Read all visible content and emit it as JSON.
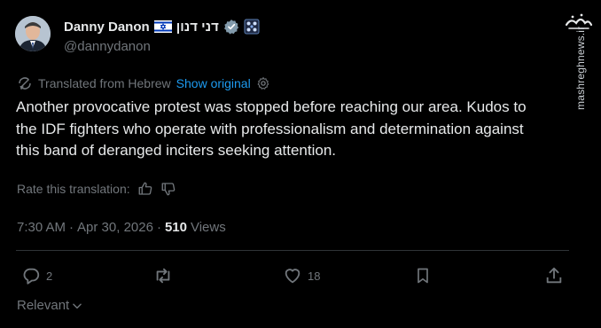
{
  "author": {
    "name": "Danny Danon",
    "name_hebrew": "דני דנון",
    "handle": "@dannydanon"
  },
  "translation": {
    "notice": "Translated from Hebrew",
    "show_original": "Show original",
    "rate_label": "Rate this translation:"
  },
  "tweet": {
    "text": "Another provocative protest was stopped before reaching our area. Kudos to the IDF fighters who operate with professionalism and determination against this band of deranged inciters seeking attention."
  },
  "meta": {
    "time": "7:30 AM",
    "sep1": "·",
    "date": "Apr 30, 2026",
    "sep2": "·",
    "views_count": "510",
    "views_label": "Views"
  },
  "actions": {
    "reply_count": "2",
    "like_count": "18"
  },
  "sort": {
    "label": "Relevant"
  },
  "watermark": {
    "text": "mashreghnews.ir",
    "logo_text": "مشرق"
  },
  "icons": {
    "flag": "israel-flag-icon",
    "verified": "verified-badge-icon",
    "affiliate": "affiliate-badge-icon",
    "translate": "translate-icon",
    "settings": "gear-icon",
    "thumbs_up": "thumbs-up-icon",
    "thumbs_down": "thumbs-down-icon",
    "reply": "reply-icon",
    "retweet": "retweet-icon",
    "like": "heart-icon",
    "bookmark": "bookmark-icon",
    "share": "share-icon",
    "chevron": "chevron-down-icon"
  },
  "colors": {
    "background": "#000000",
    "text": "#e7e9ea",
    "muted": "#71767b",
    "link": "#1d9bf0",
    "divider": "#2f3336"
  }
}
